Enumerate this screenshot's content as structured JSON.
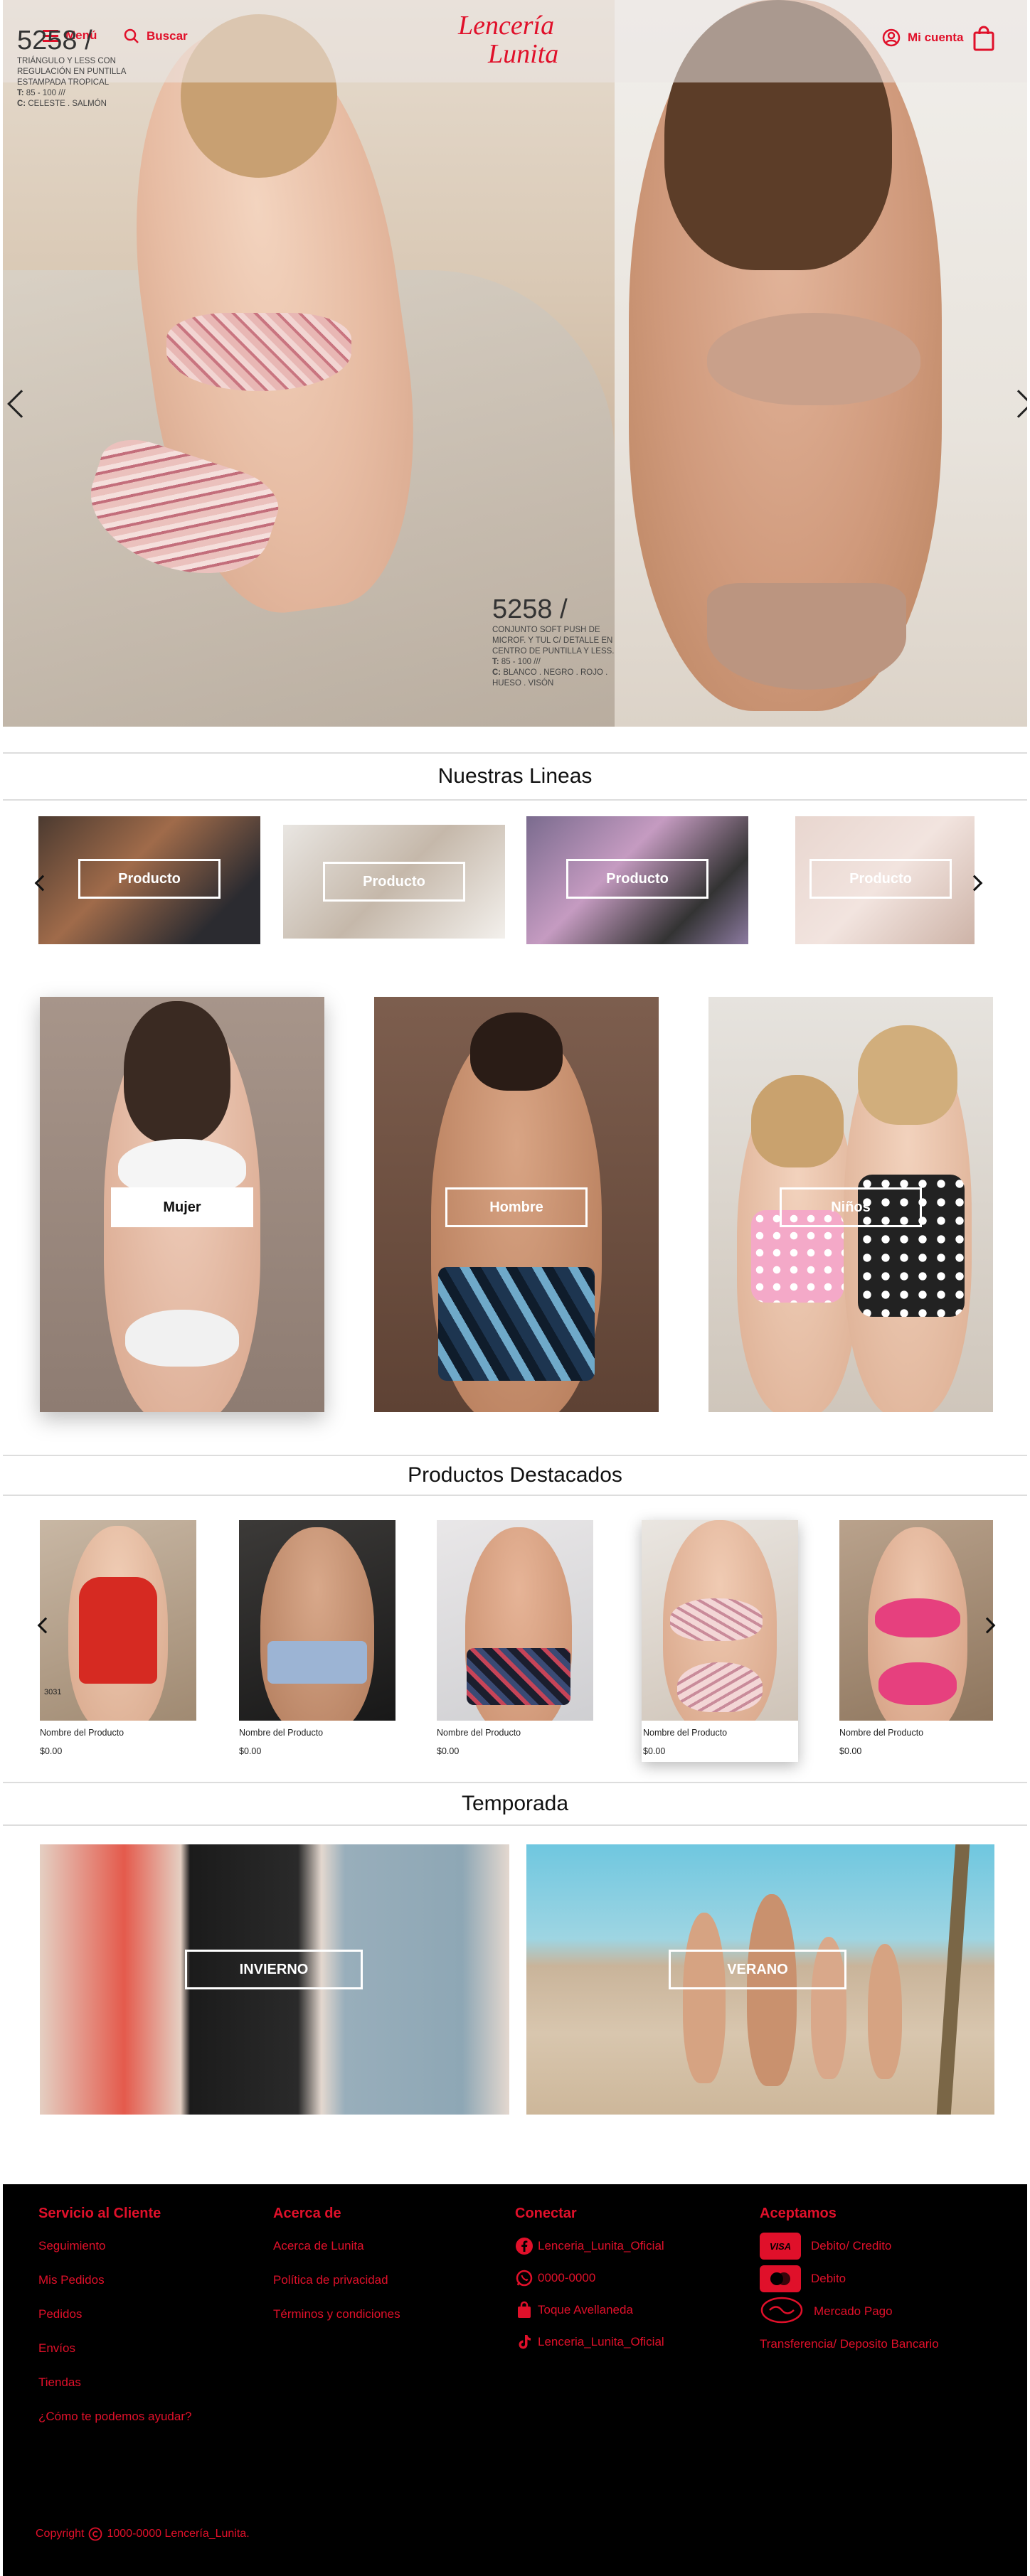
{
  "header": {
    "menu_label": "Menú",
    "search_label": "Buscar",
    "account_label": "Mi cuenta",
    "logo_line1": "Lencería",
    "logo_line2": "Lunita"
  },
  "hero": {
    "left": {
      "code": "5258 /",
      "desc_line1": "TRIÁNGULO Y LESS CON",
      "desc_line2": "REGULACIÓN EN PUNTILLA",
      "desc_line3": "ESTAMPADA TROPICAL",
      "sizes_label": "T:",
      "sizes": "85 - 100 ///",
      "colors_label": "C:",
      "colors": "CELESTE . SALMÓN"
    },
    "right": {
      "code": "5258 /",
      "desc_line1": "CONJUNTO SOFT PUSH DE",
      "desc_line2": "MICROF. Y TUL C/ DETALLE EN",
      "desc_line3": "CENTRO DE PUNTILLA Y LESS.",
      "sizes_label": "T:",
      "sizes": "85 - 100 ///",
      "colors_label": "C:",
      "colors": "BLANCO . NEGRO . ROJO .",
      "colors2": "HUESO . VISÓN"
    }
  },
  "lineas": {
    "title": "Nuestras Lineas",
    "items": [
      {
        "label": "Producto"
      },
      {
        "label": "Producto"
      },
      {
        "label": "Producto"
      },
      {
        "label": "Producto"
      }
    ]
  },
  "categories": {
    "mujer": "Mujer",
    "hombre": "Hombre",
    "ninos": "Niños"
  },
  "destacados": {
    "title": "Productos Destacados",
    "badge": "3031",
    "products": [
      {
        "name": "Nombre del Producto",
        "price": "$0.00"
      },
      {
        "name": "Nombre del Producto",
        "price": "$0.00"
      },
      {
        "name": "Nombre del Producto",
        "price": "$0.00"
      },
      {
        "name": "Nombre del Producto",
        "price": "$0.00"
      },
      {
        "name": "Nombre del Producto",
        "price": "$0.00"
      }
    ]
  },
  "temporada": {
    "title": "Temporada",
    "invierno": "INVIERNO",
    "verano": "VERANO"
  },
  "footer": {
    "servicio": {
      "title": "Servicio al Cliente",
      "links": [
        "Seguimiento",
        "Mis Pedidos",
        "Pedidos",
        "Envíos",
        "Tiendas",
        "¿Cómo te podemos ayudar?"
      ]
    },
    "acerca": {
      "title": "Acerca de",
      "links": [
        "Acerca de Lunita",
        "Política de privacidad",
        "Términos y condiciones"
      ]
    },
    "conectar": {
      "title": "Conectar",
      "facebook": "Lenceria_Lunita_Oficial",
      "whatsapp": "0000-0000",
      "store": "Toque Avellaneda",
      "tiktok": "Lenceria_Lunita_Oficial"
    },
    "aceptamos": {
      "title": "Aceptamos",
      "visa_badge": "VISA",
      "visa": "Debito/ Credito",
      "mastercard": "Debito",
      "mercadopago": "Mercado Pago",
      "transfer": "Transferencia/ Deposito Bancario"
    },
    "copyright": "Copyright",
    "copyright_text": "1000-0000 Lencería_Lunita."
  },
  "colors": {
    "brand_red": "#e0102a",
    "footer_bg": "#000000"
  }
}
